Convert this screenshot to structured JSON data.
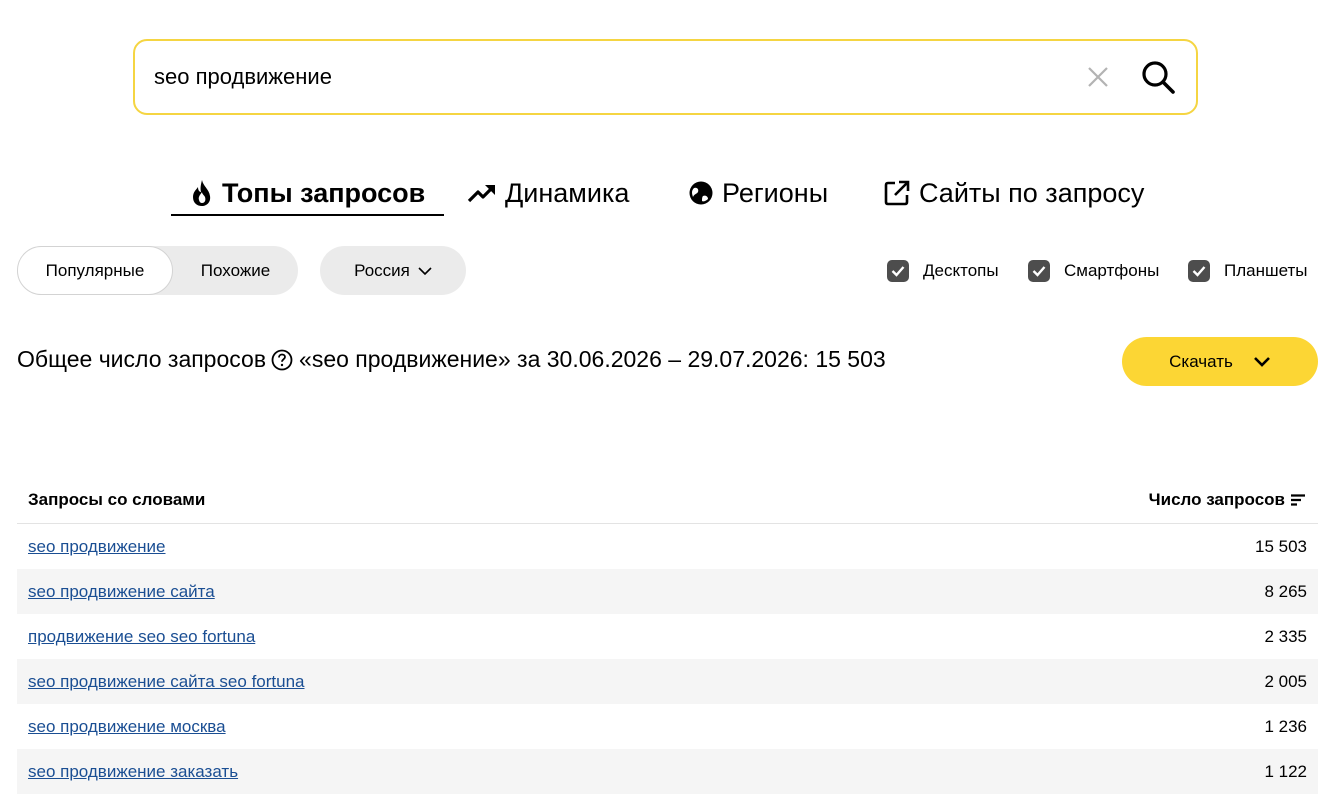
{
  "search": {
    "value": "seo продвижение",
    "placeholder": ""
  },
  "tabs": [
    {
      "label": "Топы запросов",
      "icon": "fire-icon",
      "active": true
    },
    {
      "label": "Динамика",
      "icon": "trend-up-icon"
    },
    {
      "label": "Регионы",
      "icon": "globe-icon"
    },
    {
      "label": "Сайты по запросу",
      "icon": "external-link-icon"
    }
  ],
  "filters": {
    "segment": {
      "selected": "Популярные",
      "other": "Похожие"
    },
    "region": "Россия",
    "devices": [
      {
        "label": "Десктопы",
        "checked": true
      },
      {
        "label": "Смартфоны",
        "checked": true
      },
      {
        "label": "Планшеты",
        "checked": true
      }
    ]
  },
  "total": {
    "prefix": "Общее число запросов",
    "suffix": "«seo продвижение» за 30.06.2026 – 29.07.2026: 15 503"
  },
  "download_label": "Скачать",
  "table": {
    "col_query": "Запросы со словами",
    "col_count": "Число запросов",
    "rows": [
      {
        "query": "seo продвижение",
        "count": "15 503"
      },
      {
        "query": "seo продвижение сайта",
        "count": "8 265"
      },
      {
        "query": "продвижение seo seo fortuna",
        "count": "2 335"
      },
      {
        "query": "seo продвижение сайта seo fortuna",
        "count": "2 005"
      },
      {
        "query": "seo продвижение москва",
        "count": "1 236"
      },
      {
        "query": "seo продвижение заказать",
        "count": "1 122"
      }
    ]
  },
  "colors": {
    "accent_yellow": "#fcd634",
    "search_border": "#f5d542",
    "link": "#1a4e93",
    "checkbox": "#4d4d4d"
  }
}
